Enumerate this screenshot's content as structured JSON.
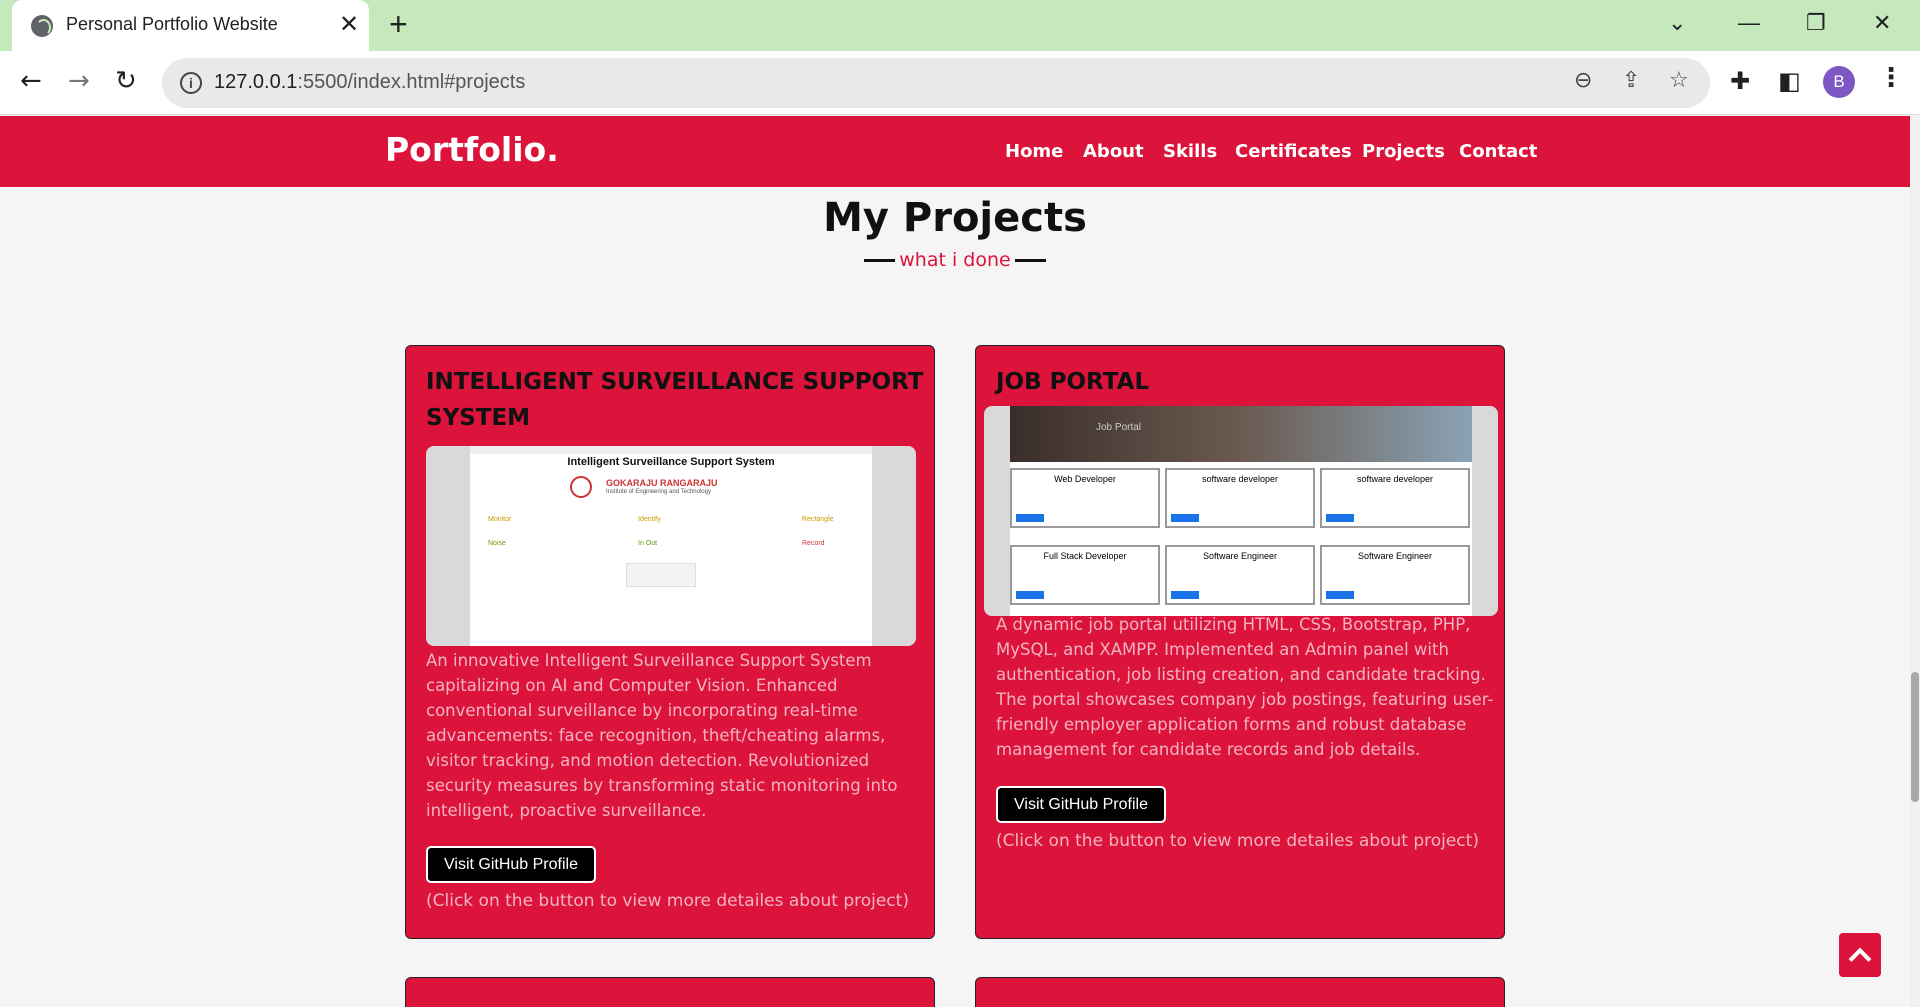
{
  "browser": {
    "tab_title": "Personal Portfolio Website",
    "url_host": "127.0.0.1",
    "url_rest": ":5500/index.html#projects",
    "avatar_letter": "B"
  },
  "nav": {
    "logo": "Portfolio.",
    "links": [
      "Home",
      "About",
      "Skills",
      "Certificates",
      "Projects",
      "Contact"
    ]
  },
  "section": {
    "title": "My Projects",
    "subtitle": "what i done"
  },
  "projects": [
    {
      "title_line1": "INTELLIGENT SURVEILLANCE SUPPORT",
      "title_line2": "SYSTEM",
      "desc": [
        "An innovative Intelligent Surveillance Support System",
        "capitalizing on AI and Computer Vision. Enhanced",
        "conventional surveillance by incorporating real-time",
        "advancements: face recognition, theft/cheating alarms,",
        "visitor tracking, and motion detection. Revolutionized",
        "security measures by transforming static monitoring into",
        "intelligent, proactive surveillance."
      ],
      "button": "Visit GitHub Profile",
      "note": "(Click on the button to view more detailes about project)",
      "screenshot": {
        "heading": "Intelligent Surveillance Support System",
        "college": "GOKARAJU RANGARAJU",
        "college_sub": "Institute of Engineering and Technology",
        "features": [
          "Monitor",
          "Identify",
          "Rectangle",
          "Noise",
          "In Out",
          "Record"
        ]
      }
    },
    {
      "title_line1": "JOB PORTAL",
      "desc": [
        "A dynamic job portal utilizing HTML, CSS, Bootstrap, PHP,",
        "MySQL, and XAMPP. Implemented an Admin panel with",
        "authentication, job listing creation, and candidate tracking.",
        "The portal showcases company job postings, featuring user-",
        "friendly employer application forms and robust database",
        "management for candidate records and job details."
      ],
      "button": "Visit GitHub Profile",
      "note": "(Click on the button to view more detailes about project)",
      "screenshot": {
        "banner": "Job Portal",
        "jobs": [
          "Web Developer",
          "software developer",
          "software developer",
          "Full Stack Developer",
          "Software Engineer",
          "Software Engineer"
        ]
      }
    }
  ],
  "colors": {
    "accent": "#dc143c",
    "tabbar": "#c6e8bd"
  },
  "icons": [
    "globe-icon",
    "close-icon",
    "plus-icon",
    "back-icon",
    "forward-icon",
    "reload-icon",
    "info-icon",
    "zoom-out-icon",
    "share-icon",
    "star-icon",
    "extensions-icon",
    "sidepanel-icon",
    "menu-icon",
    "arrow-up-icon"
  ]
}
